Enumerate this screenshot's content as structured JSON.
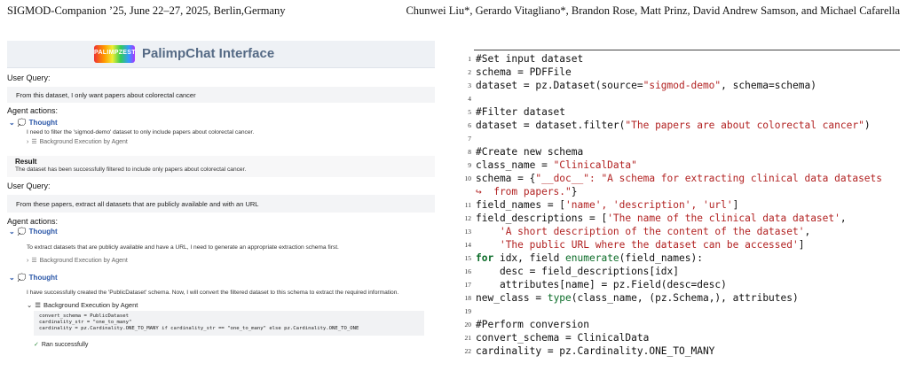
{
  "header": {
    "left": "SIGMOD-Companion ’25, June 22–27, 2025, Berlin,Germany",
    "right": "Chunwei Liu*, Gerardo Vitagliano*, Brandon Rose, Matt Prinz, David Andrew Samson, and Michael Cafarella"
  },
  "ui": {
    "logo_text": "PALIMPZEST",
    "title": "PalimpChat Interface",
    "user_query_label": "User Query:",
    "agent_actions_label": "Agent actions:",
    "thought_label": "Thought",
    "bg_exec_label": "Background Execution by Agent",
    "result_label": "Result",
    "ran_successfully": "Ran successfully",
    "query1": "From this dataset, I only want papers about colorectal cancer",
    "thought1": "I need to filter the 'sigmod-demo' dataset to only include papers about colorectal cancer.",
    "result1": "The dataset has been successfully filtered to include only papers about colorectal cancer.",
    "query2": "From these papers, extract all datasets that are publicly available and with an URL",
    "thought2": "To extract datasets that are publicly available and have a URL, I need to generate an appropriate extraction schema first.",
    "thought3": "I have successfully created the 'PublicDataset' schema. Now, I will convert the filtered dataset to this schema to extract the required information.",
    "code_lines": [
      "convert_schema = PublicDataset",
      "cardinality_str = \"one_to_many\"",
      "cardinality = pz.Cardinality.ONE_TO_MANY if cardinality_str == \"one_to_many\" else pz.Cardinality.ONE_TO_ONE"
    ]
  },
  "listing": {
    "line_numbers": [
      "1",
      "2",
      "3",
      "4",
      "5",
      "6",
      "7",
      "8",
      "9",
      "10",
      "",
      "11",
      "12",
      "13",
      "14",
      "15",
      "16",
      "17",
      "18",
      "19",
      "20",
      "21",
      "22"
    ],
    "l1": "#Set input dataset",
    "l2a": "schema = PDFFile",
    "l3a": "dataset = pz.Dataset(source=",
    "l3s": "\"sigmod-demo\"",
    "l3b": ", schema=schema)",
    "l5": "#Filter dataset",
    "l6a": "dataset = dataset.filter(",
    "l6s": "\"The papers are about colorectal cancer\"",
    "l6b": ")",
    "l8": "#Create new schema",
    "l9a": "class_name = ",
    "l9s": "\"ClinicalData\"",
    "l10a": "schema = {",
    "l10s": "\"__doc__\": \"A schema for extracting clinical data datasets",
    "l10c": "↪  from papers.\"",
    "l10d": "}",
    "l11a": "field_names = [",
    "l11s": "'name', 'description', 'url'",
    "l11b": "]",
    "l12a": "field_descriptions = [",
    "l12s": "'The name of the clinical data dataset'",
    "l12b": ",",
    "l13s": "'A short description of the content of the dataset'",
    "l13b": ",",
    "l14s": "'The public URL where the dataset can be accessed'",
    "l14b": "]",
    "l15k": "for",
    "l15a": " idx, field ",
    "l15b": "enumerate",
    "l15c": "(field_names):",
    "l16": "    desc = field_descriptions[idx]",
    "l17": "    attributes[name] = pz.Field(desc=desc)",
    "l18a": "new_class = ",
    "l18b": "type",
    "l18c": "(class_name, (pz.Schema,), attributes)",
    "l20": "#Perform conversion",
    "l21": "convert_schema = ClinicalData",
    "l22": "cardinality = pz.Cardinality.ONE_TO_MANY"
  }
}
